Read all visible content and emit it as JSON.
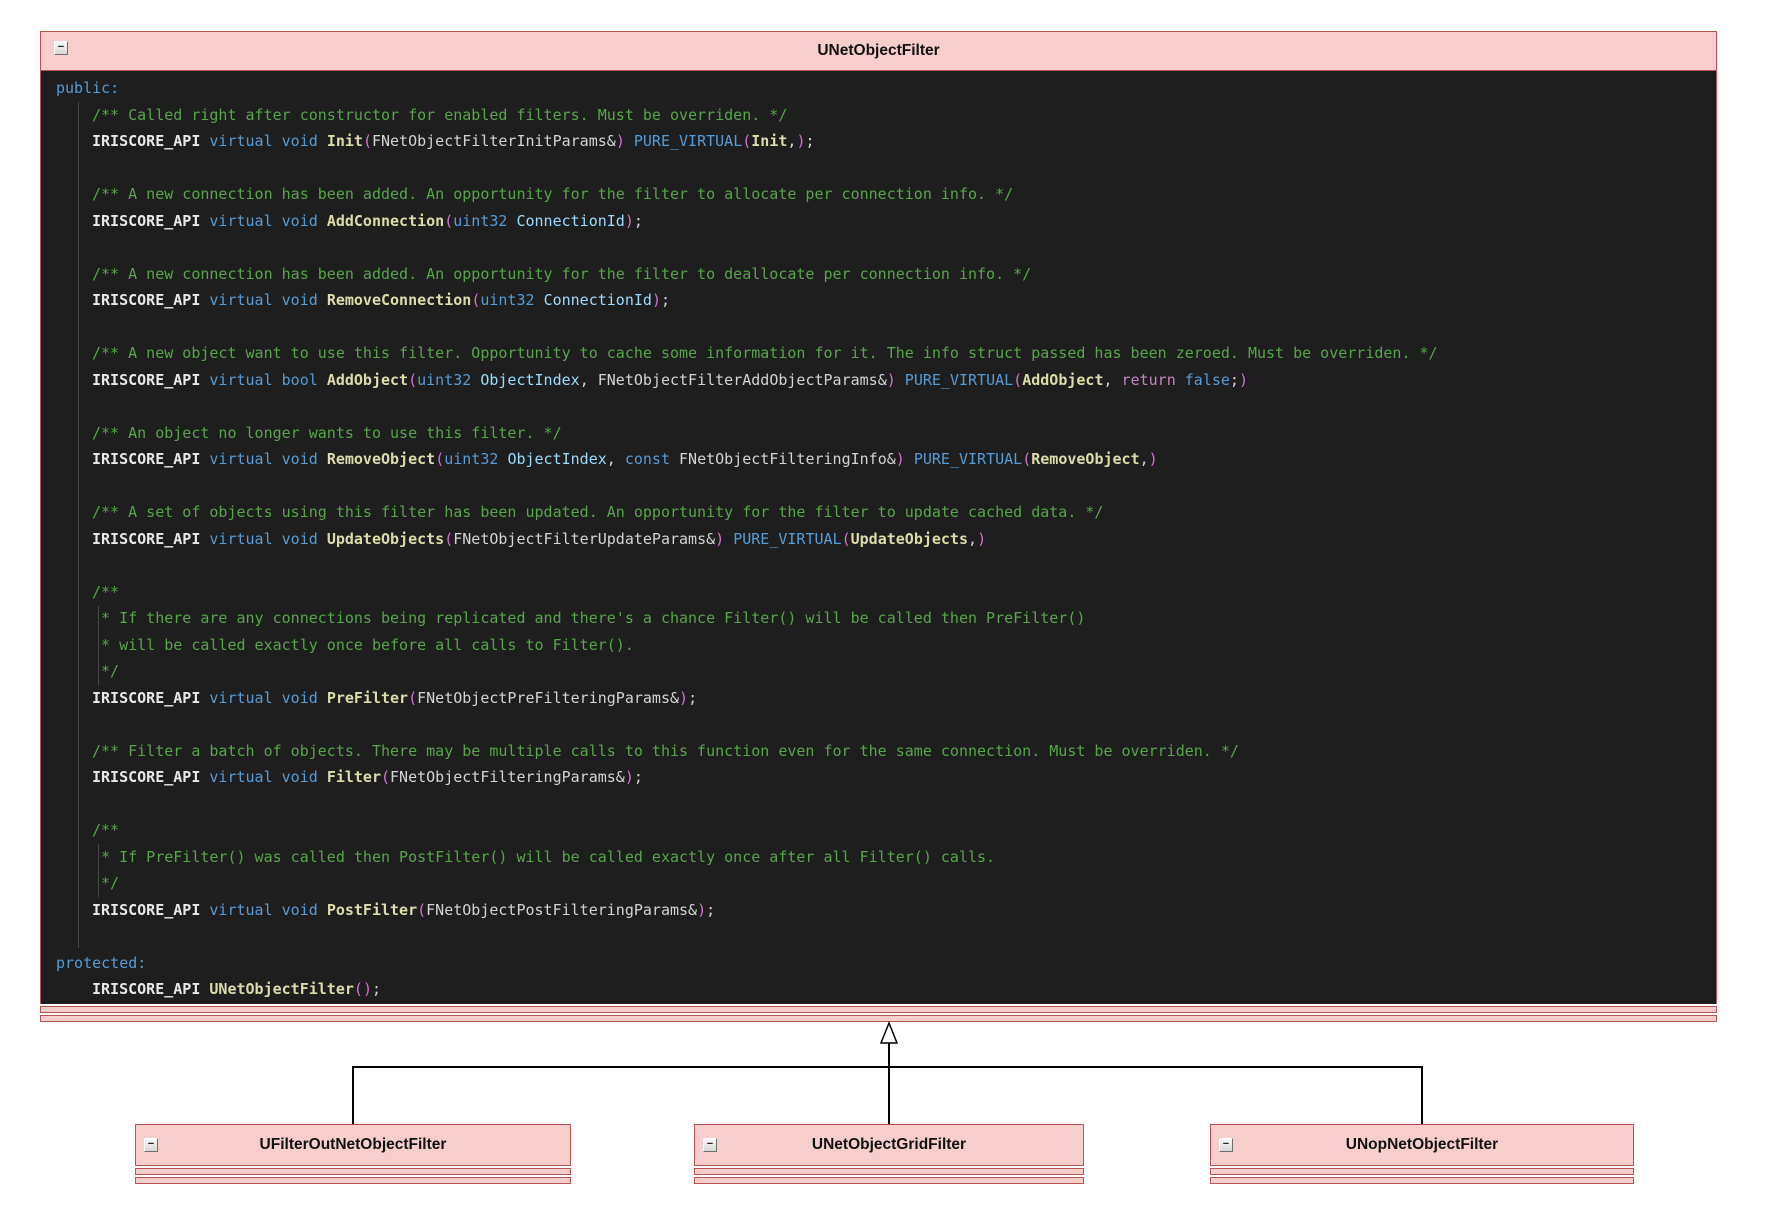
{
  "diagram": {
    "title": "UNetObjectFilter",
    "collapse_glyph": "−",
    "children": [
      {
        "title": "UFilterOutNetObjectFilter"
      },
      {
        "title": "UNetObjectGridFilter"
      },
      {
        "title": "UNopNetObjectFilter"
      }
    ]
  },
  "colors": {
    "box_fill": "#F8CECC",
    "box_border": "#B85450",
    "code_background": "#1E1E1E",
    "comment_green": "#57A64A",
    "keyword_blue": "#569CD6",
    "function_yellow": "#DCDCAA",
    "macro_white": "#E8E8E8",
    "parameter_blue": "#9CDCFE",
    "plain_text": "#D4D4D4",
    "bracket_orchid": "#D670D6",
    "control_pink": "#C586C0",
    "connector_black": "#000000"
  },
  "code": {
    "lines": [
      {
        "ind": 0,
        "tk": [
          [
            "kw",
            "public:"
          ]
        ]
      },
      {
        "ind": 1,
        "tk": [
          [
            "cm",
            "/** Called right after constructor for enabled filters. Must be overriden. */"
          ]
        ]
      },
      {
        "ind": 1,
        "tk": [
          [
            "api",
            "IRISCORE_API "
          ],
          [
            "kw",
            "virtual "
          ],
          [
            "kw",
            "void "
          ],
          [
            "fn",
            "Init"
          ],
          [
            "br",
            "("
          ],
          [
            "pl",
            "FNetObjectFilterInitParams&"
          ],
          [
            "br",
            ")"
          ],
          [
            "pl",
            " "
          ],
          [
            "kw",
            "PURE_VIRTUAL"
          ],
          [
            "br",
            "("
          ],
          [
            "fn",
            "Init"
          ],
          [
            "pl",
            ","
          ],
          [
            "br",
            ")"
          ],
          [
            "pl",
            ";"
          ]
        ]
      },
      {
        "ind": 0,
        "tk": []
      },
      {
        "ind": 1,
        "tk": [
          [
            "cm",
            "/** A new connection has been added. An opportunity for the filter to allocate per connection info. */"
          ]
        ]
      },
      {
        "ind": 1,
        "tk": [
          [
            "api",
            "IRISCORE_API "
          ],
          [
            "kw",
            "virtual "
          ],
          [
            "kw",
            "void "
          ],
          [
            "fn",
            "AddConnection"
          ],
          [
            "br",
            "("
          ],
          [
            "kw",
            "uint32 "
          ],
          [
            "pm",
            "ConnectionId"
          ],
          [
            "br",
            ")"
          ],
          [
            "pl",
            ";"
          ]
        ]
      },
      {
        "ind": 0,
        "tk": []
      },
      {
        "ind": 1,
        "tk": [
          [
            "cm",
            "/** A new connection has been added. An opportunity for the filter to deallocate per connection info. */"
          ]
        ]
      },
      {
        "ind": 1,
        "tk": [
          [
            "api",
            "IRISCORE_API "
          ],
          [
            "kw",
            "virtual "
          ],
          [
            "kw",
            "void "
          ],
          [
            "fn",
            "RemoveConnection"
          ],
          [
            "br",
            "("
          ],
          [
            "kw",
            "uint32 "
          ],
          [
            "pm",
            "ConnectionId"
          ],
          [
            "br",
            ")"
          ],
          [
            "pl",
            ";"
          ]
        ]
      },
      {
        "ind": 0,
        "tk": []
      },
      {
        "ind": 1,
        "tk": [
          [
            "cm",
            "/** A new object want to use this filter. Opportunity to cache some information for it. The info struct passed has been zeroed. Must be overriden. */"
          ]
        ]
      },
      {
        "ind": 1,
        "tk": [
          [
            "api",
            "IRISCORE_API "
          ],
          [
            "kw",
            "virtual "
          ],
          [
            "kw",
            "bool "
          ],
          [
            "fn",
            "AddObject"
          ],
          [
            "br",
            "("
          ],
          [
            "kw",
            "uint32 "
          ],
          [
            "pm",
            "ObjectIndex"
          ],
          [
            "pl",
            ", "
          ],
          [
            "pl",
            "FNetObjectFilterAddObjectParams&"
          ],
          [
            "br",
            ")"
          ],
          [
            "pl",
            " "
          ],
          [
            "kw",
            "PURE_VIRTUAL"
          ],
          [
            "br",
            "("
          ],
          [
            "fn",
            "AddObject"
          ],
          [
            "pl",
            ", "
          ],
          [
            "ctl",
            "return "
          ],
          [
            "kw",
            "false"
          ],
          [
            "pl",
            ";"
          ],
          [
            "br",
            ")"
          ]
        ]
      },
      {
        "ind": 0,
        "tk": []
      },
      {
        "ind": 1,
        "tk": [
          [
            "cm",
            "/** An object no longer wants to use this filter. */"
          ]
        ]
      },
      {
        "ind": 1,
        "tk": [
          [
            "api",
            "IRISCORE_API "
          ],
          [
            "kw",
            "virtual "
          ],
          [
            "kw",
            "void "
          ],
          [
            "fn",
            "RemoveObject"
          ],
          [
            "br",
            "("
          ],
          [
            "kw",
            "uint32 "
          ],
          [
            "pm",
            "ObjectIndex"
          ],
          [
            "pl",
            ", "
          ],
          [
            "kw",
            "const "
          ],
          [
            "pl",
            "FNetObjectFilteringInfo&"
          ],
          [
            "br",
            ")"
          ],
          [
            "pl",
            " "
          ],
          [
            "kw",
            "PURE_VIRTUAL"
          ],
          [
            "br",
            "("
          ],
          [
            "fn",
            "RemoveObject"
          ],
          [
            "pl",
            ","
          ],
          [
            "br",
            ")"
          ]
        ]
      },
      {
        "ind": 0,
        "tk": []
      },
      {
        "ind": 1,
        "tk": [
          [
            "cm",
            "/** A set of objects using this filter has been updated. An opportunity for the filter to update cached data. */"
          ]
        ]
      },
      {
        "ind": 1,
        "tk": [
          [
            "api",
            "IRISCORE_API "
          ],
          [
            "kw",
            "virtual "
          ],
          [
            "kw",
            "void "
          ],
          [
            "fn",
            "UpdateObjects"
          ],
          [
            "br",
            "("
          ],
          [
            "pl",
            "FNetObjectFilterUpdateParams&"
          ],
          [
            "br",
            ")"
          ],
          [
            "pl",
            " "
          ],
          [
            "kw",
            "PURE_VIRTUAL"
          ],
          [
            "br",
            "("
          ],
          [
            "fn",
            "UpdateObjects"
          ],
          [
            "pl",
            ","
          ],
          [
            "br",
            ")"
          ]
        ]
      },
      {
        "ind": 0,
        "tk": []
      },
      {
        "ind": 1,
        "tk": [
          [
            "cm",
            "/**"
          ]
        ]
      },
      {
        "ind": 1,
        "tk": [
          [
            "cm",
            " * If there are any connections being replicated and there's a chance Filter() will be called then PreFilter()"
          ]
        ]
      },
      {
        "ind": 1,
        "tk": [
          [
            "cm",
            " * will be called exactly once before all calls to Filter()."
          ]
        ]
      },
      {
        "ind": 1,
        "tk": [
          [
            "cm",
            " */"
          ]
        ]
      },
      {
        "ind": 1,
        "tk": [
          [
            "api",
            "IRISCORE_API "
          ],
          [
            "kw",
            "virtual "
          ],
          [
            "kw",
            "void "
          ],
          [
            "fn",
            "PreFilter"
          ],
          [
            "br",
            "("
          ],
          [
            "pl",
            "FNetObjectPreFilteringParams&"
          ],
          [
            "br",
            ")"
          ],
          [
            "pl",
            ";"
          ]
        ]
      },
      {
        "ind": 0,
        "tk": []
      },
      {
        "ind": 1,
        "tk": [
          [
            "cm",
            "/** Filter a batch of objects. There may be multiple calls to this function even for the same connection. Must be overriden. */"
          ]
        ]
      },
      {
        "ind": 1,
        "tk": [
          [
            "api",
            "IRISCORE_API "
          ],
          [
            "kw",
            "virtual "
          ],
          [
            "kw",
            "void "
          ],
          [
            "fn",
            "Filter"
          ],
          [
            "br",
            "("
          ],
          [
            "pl",
            "FNetObjectFilteringParams&"
          ],
          [
            "br",
            ")"
          ],
          [
            "pl",
            ";"
          ]
        ]
      },
      {
        "ind": 0,
        "tk": []
      },
      {
        "ind": 1,
        "tk": [
          [
            "cm",
            "/**"
          ]
        ]
      },
      {
        "ind": 1,
        "tk": [
          [
            "cm",
            " * If PreFilter() was called then PostFilter() will be called exactly once after all Filter() calls."
          ]
        ]
      },
      {
        "ind": 1,
        "tk": [
          [
            "cm",
            " */"
          ]
        ]
      },
      {
        "ind": 1,
        "tk": [
          [
            "api",
            "IRISCORE_API "
          ],
          [
            "kw",
            "virtual "
          ],
          [
            "kw",
            "void "
          ],
          [
            "fn",
            "PostFilter"
          ],
          [
            "br",
            "("
          ],
          [
            "pl",
            "FNetObjectPostFilteringParams&"
          ],
          [
            "br",
            ")"
          ],
          [
            "pl",
            ";"
          ]
        ]
      },
      {
        "ind": 0,
        "tk": []
      },
      {
        "ind": 0,
        "tk": [
          [
            "kw",
            "protected:"
          ]
        ]
      },
      {
        "ind": 1,
        "tk": [
          [
            "api",
            "IRISCORE_API "
          ],
          [
            "fn",
            "UNetObjectFilter"
          ],
          [
            "br",
            "("
          ],
          [
            "br",
            ")"
          ],
          [
            "pl",
            ";"
          ]
        ]
      }
    ]
  }
}
